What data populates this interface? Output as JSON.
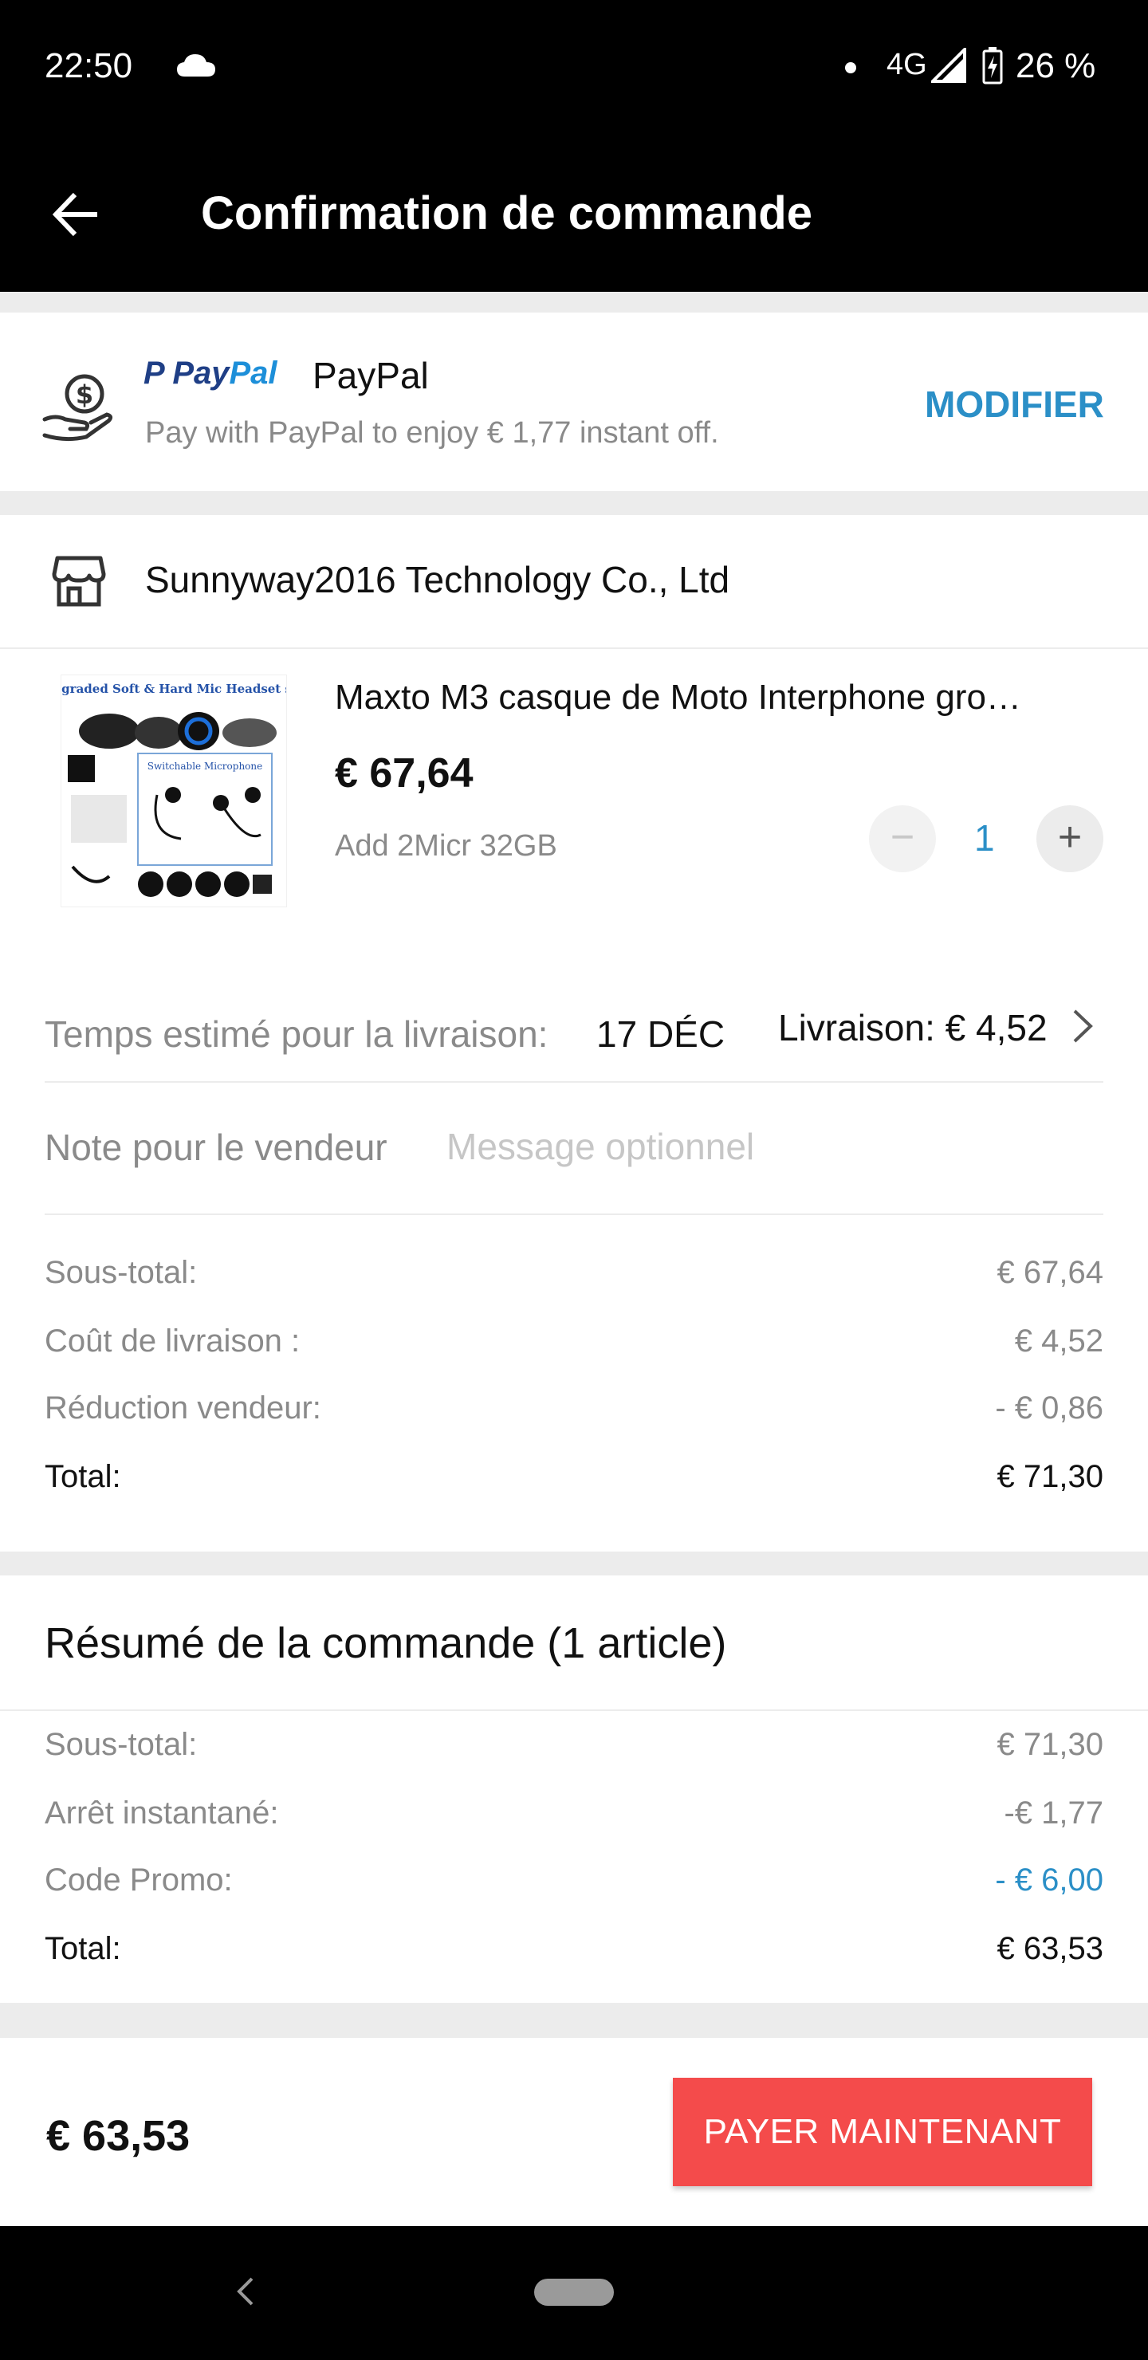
{
  "status_bar": {
    "time": "22:50",
    "network": "4G",
    "battery": "26 %",
    "icons": [
      "cloud-icon",
      "signal-icon",
      "battery-charging-icon"
    ]
  },
  "app_bar": {
    "title": "Confirmation de commande",
    "back_icon": "arrow-left-icon"
  },
  "payment": {
    "logo_text_1": "Pay",
    "logo_text_2": "Pal",
    "method": "PayPal",
    "subtitle": "Pay with PayPal to enjoy € 1,77 instant off.",
    "modify_label": "MODIFIER",
    "icon": "hand-money-icon"
  },
  "store": {
    "name": "Sunnyway2016  Technology Co., Ltd",
    "icon": "store-icon"
  },
  "product": {
    "name": "Maxto M3 casque de Moto Interphone gro…",
    "price": "€ 67,64",
    "variant": "Add 2Micr 32GB",
    "quantity": "1",
    "image_caption_top": "Upgraded Soft & Hard Mic Headset set",
    "image_caption_mid": "Switchable Microphone"
  },
  "delivery": {
    "eta_label": "Temps estimé pour la livraison:",
    "eta_value": "17 DÉC",
    "shipping": "Livraison: € 4,52"
  },
  "note": {
    "label": "Note pour le vendeur",
    "placeholder": "Message optionnel",
    "value": ""
  },
  "store_totals": [
    {
      "label": "Sous-total:",
      "value": "€ 67,64",
      "style": "muted"
    },
    {
      "label": "Coût de livraison :",
      "value": "€ 4,52",
      "style": "muted"
    },
    {
      "label": "Réduction vendeur:",
      "value": "- € 0,86",
      "style": "muted"
    },
    {
      "label": "Total:",
      "value": "€ 71,30",
      "style": "dark"
    }
  ],
  "summary": {
    "title": "Résumé de la commande (1 article)",
    "rows": [
      {
        "label": "Sous-total:",
        "value": "€ 71,30",
        "style": "muted"
      },
      {
        "label": "Arrêt instantané:",
        "value": "-€ 1,77",
        "style": "muted"
      },
      {
        "label": "Code Promo:",
        "value": "- € 6,00",
        "style": "blue"
      },
      {
        "label": "Total:",
        "value": "€ 63,53",
        "style": "dark"
      }
    ]
  },
  "bottom": {
    "total": "€ 63,53",
    "pay_label": "PAYER MAINTENANT"
  },
  "colors": {
    "accent_blue": "#2b8fc7",
    "pay_red": "#f44b4b",
    "paypal_dark": "#1f3f86",
    "paypal_light": "#1d8fd9"
  }
}
